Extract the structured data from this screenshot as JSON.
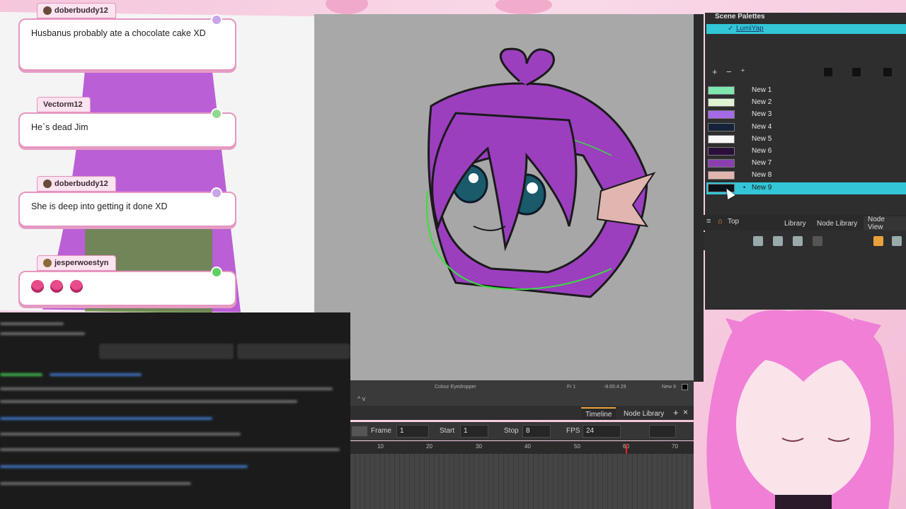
{
  "chat": {
    "messages": [
      {
        "user": "doberbuddy12",
        "text": "Husbanus probably ate a chocolate cake XD"
      },
      {
        "user": "Vectorm12",
        "text": "He`s dead Jim"
      },
      {
        "user": "doberbuddy12",
        "text": "She is deep into getting it done XD"
      },
      {
        "user": "jesperwoestyn",
        "text": ""
      }
    ]
  },
  "status_bar": {
    "tool": "Colour Eyedropper",
    "frame": "Fr 1",
    "coords": "-8.65:4.29",
    "swatch": "New 9"
  },
  "timeline": {
    "tabs": [
      "Timeline",
      "Node Library"
    ],
    "frame_label": "Frame",
    "frame_value": "1",
    "start_label": "Start",
    "start_value": "1",
    "stop_label": "Stop",
    "stop_value": "8",
    "fps_label": "FPS",
    "fps_value": "24",
    "ruler": [
      "10",
      "20",
      "30",
      "40",
      "50",
      "60",
      "70"
    ]
  },
  "palettes": {
    "title": "Scene Palettes",
    "palette_name": "LumiYap",
    "swatches": [
      {
        "name": "New 1",
        "color": "#7fe6b0"
      },
      {
        "name": "New 2",
        "color": "#dff3d3"
      },
      {
        "name": "New 3",
        "color": "#a66ae6"
      },
      {
        "name": "New 4",
        "color": "#14233a"
      },
      {
        "name": "New 5",
        "color": "#f7f7f7"
      },
      {
        "name": "New 6",
        "color": "#2a0f3a"
      },
      {
        "name": "New 7",
        "color": "#8a3fb0"
      },
      {
        "name": "New 8",
        "color": "#e2b6b0"
      },
      {
        "name": "New 9",
        "color": "#0c1318"
      }
    ],
    "selected_index": 8
  },
  "node_view": {
    "top_label": "Top",
    "tabs": [
      "Library",
      "Node Library",
      "Node View"
    ]
  }
}
